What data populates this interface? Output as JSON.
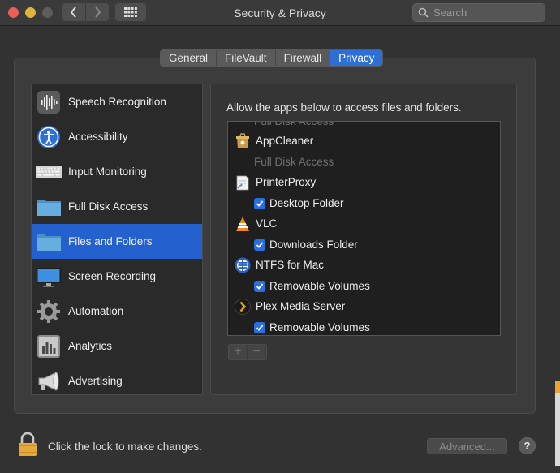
{
  "window": {
    "title": "Security & Privacy",
    "search_placeholder": "Search"
  },
  "tabs": [
    {
      "label": "General",
      "active": false
    },
    {
      "label": "FileVault",
      "active": false
    },
    {
      "label": "Firewall",
      "active": false
    },
    {
      "label": "Privacy",
      "active": true
    }
  ],
  "sidebar": {
    "items": [
      {
        "label": "Speech Recognition",
        "icon": "waveform-icon"
      },
      {
        "label": "Accessibility",
        "icon": "accessibility-icon"
      },
      {
        "label": "Input Monitoring",
        "icon": "keyboard-icon"
      },
      {
        "label": "Full Disk Access",
        "icon": "folder-icon"
      },
      {
        "label": "Files and Folders",
        "icon": "folder-icon",
        "selected": true
      },
      {
        "label": "Screen Recording",
        "icon": "display-icon"
      },
      {
        "label": "Automation",
        "icon": "gear-icon"
      },
      {
        "label": "Analytics",
        "icon": "chart-icon"
      },
      {
        "label": "Advertising",
        "icon": "megaphone-icon"
      }
    ]
  },
  "content": {
    "description": "Allow the apps below to access files and folders.",
    "list": {
      "partial_top": "Full Disk Access",
      "appcleaner": {
        "name": "AppCleaner",
        "group": "Full Disk Access"
      },
      "printerproxy": {
        "name": "PrinterProxy",
        "permission": "Desktop Folder",
        "checked": true
      },
      "vlc": {
        "name": "VLC",
        "permission": "Downloads Folder",
        "checked": true
      },
      "ntfs": {
        "name": "NTFS for Mac",
        "permission": "Removable Volumes",
        "checked": true
      },
      "plex": {
        "name": "Plex Media Server",
        "permission": "Removable Volumes",
        "checked": true
      }
    },
    "add_label": "+",
    "remove_label": "−"
  },
  "footer": {
    "lock_message": "Click the lock to make changes.",
    "advanced_label": "Advanced...",
    "help_label": "?"
  },
  "colors": {
    "accent": "#2461cf",
    "checkbox": "#2a6fe0"
  }
}
